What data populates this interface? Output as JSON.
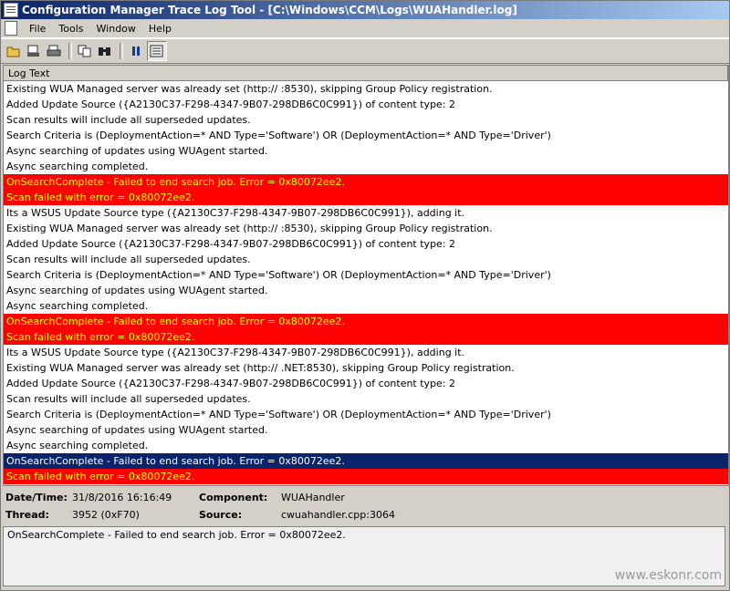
{
  "window": {
    "title": "Configuration Manager Trace Log Tool - [C:\\Windows\\CCM\\Logs\\WUAHandler.log]"
  },
  "menu": {
    "items": [
      "File",
      "Tools",
      "Window",
      "Help"
    ]
  },
  "toolbar": {
    "buttons": [
      "open-icon",
      "print-preview-icon",
      "print-icon",
      "copy-icon",
      "find-icon",
      "pause-icon",
      "show-details-icon"
    ]
  },
  "log": {
    "column_header": "Log Text",
    "entries": [
      {
        "text": "Existing WUA Managed server was already set (http://                                                   :8530), skipping Group Policy registration.",
        "level": "normal"
      },
      {
        "text": "Added Update Source ({A2130C37-F298-4347-9B07-298DB6C0C991}) of content type: 2",
        "level": "normal"
      },
      {
        "text": "Scan results will include all superseded updates.",
        "level": "normal"
      },
      {
        "text": "Search Criteria is (DeploymentAction=* AND Type='Software') OR (DeploymentAction=* AND Type='Driver')",
        "level": "normal"
      },
      {
        "text": "Async searching of updates using WUAgent started.",
        "level": "normal"
      },
      {
        "text": "Async searching completed.",
        "level": "normal"
      },
      {
        "text": "OnSearchComplete - Failed to end search job. Error = 0x80072ee2.",
        "level": "error"
      },
      {
        "text": "Scan failed with error = 0x80072ee2.",
        "level": "error"
      },
      {
        "text": "Its a WSUS Update Source type ({A2130C37-F298-4347-9B07-298DB6C0C991}), adding it.",
        "level": "normal"
      },
      {
        "text": "Existing WUA Managed server was already set (http://                                                   :8530), skipping Group Policy registration.",
        "level": "normal"
      },
      {
        "text": "Added Update Source ({A2130C37-F298-4347-9B07-298DB6C0C991}) of content type: 2",
        "level": "normal"
      },
      {
        "text": "Scan results will include all superseded updates.",
        "level": "normal"
      },
      {
        "text": "Search Criteria is (DeploymentAction=* AND Type='Software') OR (DeploymentAction=* AND Type='Driver')",
        "level": "normal"
      },
      {
        "text": "Async searching of updates using WUAgent started.",
        "level": "normal"
      },
      {
        "text": "Async searching completed.",
        "level": "normal"
      },
      {
        "text": "OnSearchComplete - Failed to end search job. Error = 0x80072ee2.",
        "level": "error"
      },
      {
        "text": "Scan failed with error = 0x80072ee2.",
        "level": "error"
      },
      {
        "text": "Its a WSUS Update Source type ({A2130C37-F298-4347-9B07-298DB6C0C991}), adding it.",
        "level": "normal"
      },
      {
        "text": "Existing WUA Managed server was already set (http://                                                   .NET:8530), skipping Group Policy registration.",
        "level": "normal"
      },
      {
        "text": "Added Update Source ({A2130C37-F298-4347-9B07-298DB6C0C991}) of content type: 2",
        "level": "normal"
      },
      {
        "text": "Scan results will include all superseded updates.",
        "level": "normal"
      },
      {
        "text": "Search Criteria is (DeploymentAction=* AND Type='Software') OR (DeploymentAction=* AND Type='Driver')",
        "level": "normal"
      },
      {
        "text": "Async searching of updates using WUAgent started.",
        "level": "normal"
      },
      {
        "text": "Async searching completed.",
        "level": "normal"
      },
      {
        "text": "OnSearchComplete - Failed to end search job. Error = 0x80072ee2.",
        "level": "selected"
      },
      {
        "text": "Scan failed with error = 0x80072ee2.",
        "level": "error"
      }
    ]
  },
  "details": {
    "datetime_label": "Date/Time:",
    "datetime_value": "31/8/2016 16:16:49",
    "component_label": "Component:",
    "component_value": "WUAHandler",
    "thread_label": "Thread:",
    "thread_value": "3952 (0xF70)",
    "source_label": "Source:",
    "source_value": "cwuahandler.cpp:3064"
  },
  "message": {
    "text": "OnSearchComplete - Failed to end search job. Error = 0x80072ee2."
  },
  "watermark": "www.eskonr.com",
  "colors": {
    "error_bg": "#ff0000",
    "error_fg": "#ffff00",
    "selected_bg": "#0a246a"
  }
}
